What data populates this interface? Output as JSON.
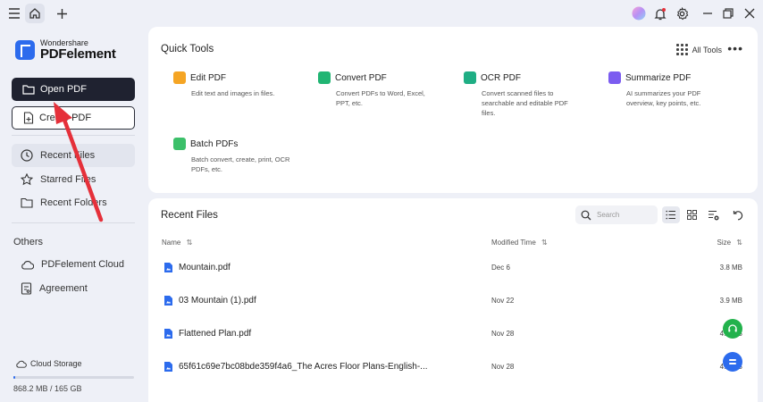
{
  "app": {
    "brand_small": "Wondershare",
    "brand_name": "PDFelement"
  },
  "titlebar": {
    "icons": [
      "menu-icon",
      "home-icon",
      "plus-icon",
      "avatar-icon",
      "bell-icon",
      "gear-icon",
      "minimize-icon",
      "restore-icon",
      "close-icon"
    ]
  },
  "sidebar": {
    "open_label": "Open PDF",
    "create_label": "Create PDF",
    "nav": [
      {
        "label": "Recent Files",
        "icon": "clock-icon",
        "active": true
      },
      {
        "label": "Starred Files",
        "icon": "star-icon",
        "active": false
      },
      {
        "label": "Recent Folders",
        "icon": "folder-icon",
        "active": false
      }
    ],
    "others_heading": "Others",
    "others": [
      {
        "label": "PDFelement Cloud",
        "icon": "cloud-icon"
      },
      {
        "label": "Agreement",
        "icon": "agreement-icon"
      }
    ],
    "storage_label": "Cloud Storage",
    "storage_text": "868.2 MB / 165 GB",
    "storage_used_fraction": 0.005
  },
  "quick_tools": {
    "title": "Quick Tools",
    "all_tools_label": "All Tools",
    "more_label": "•••",
    "tools": [
      {
        "name": "Edit PDF",
        "desc": "Edit text and images in files.",
        "icon": "edit-pdf-icon",
        "color": "#f5a524"
      },
      {
        "name": "Convert PDF",
        "desc": "Convert PDFs to Word, Excel, PPT, etc.",
        "icon": "convert-pdf-icon",
        "color": "#21b573"
      },
      {
        "name": "OCR PDF",
        "desc": "Convert scanned files to searchable and editable PDF files.",
        "icon": "ocr-pdf-icon",
        "color": "#1fae84"
      },
      {
        "name": "Summarize PDF",
        "desc": "AI summarizes your PDF overview, key points, etc.",
        "icon": "summarize-pdf-icon",
        "color": "#7b5cf0"
      },
      {
        "name": "Batch PDFs",
        "desc": "Batch convert, create, print, OCR PDFs, etc.",
        "icon": "batch-pdfs-icon",
        "color": "#3cc06a"
      }
    ]
  },
  "recent": {
    "title": "Recent Files",
    "search_placeholder": "Search",
    "columns": {
      "name": "Name",
      "modified": "Modified Time",
      "size": "Size"
    },
    "sort_icon": "⇅",
    "files": [
      {
        "name": "Mountain.pdf",
        "modified": "Dec 6",
        "size": "3.8 MB"
      },
      {
        "name": "03 Mountain (1).pdf",
        "modified": "Nov 22",
        "size": "3.9 MB"
      },
      {
        "name": "Flattened Plan.pdf",
        "modified": "Nov 28",
        "size": "4.4 MB"
      },
      {
        "name": "65f61c69e7bc08bde359f4a6_The Acres Floor Plans-English-...",
        "modified": "Nov 28",
        "size": "4.4 MB"
      }
    ]
  },
  "colors": {
    "accent": "#2c6bed",
    "dark_button": "#1f2230",
    "annotation_arrow": "#e5303a",
    "support_green": "#22b24c",
    "support_blue": "#2c6bed"
  }
}
